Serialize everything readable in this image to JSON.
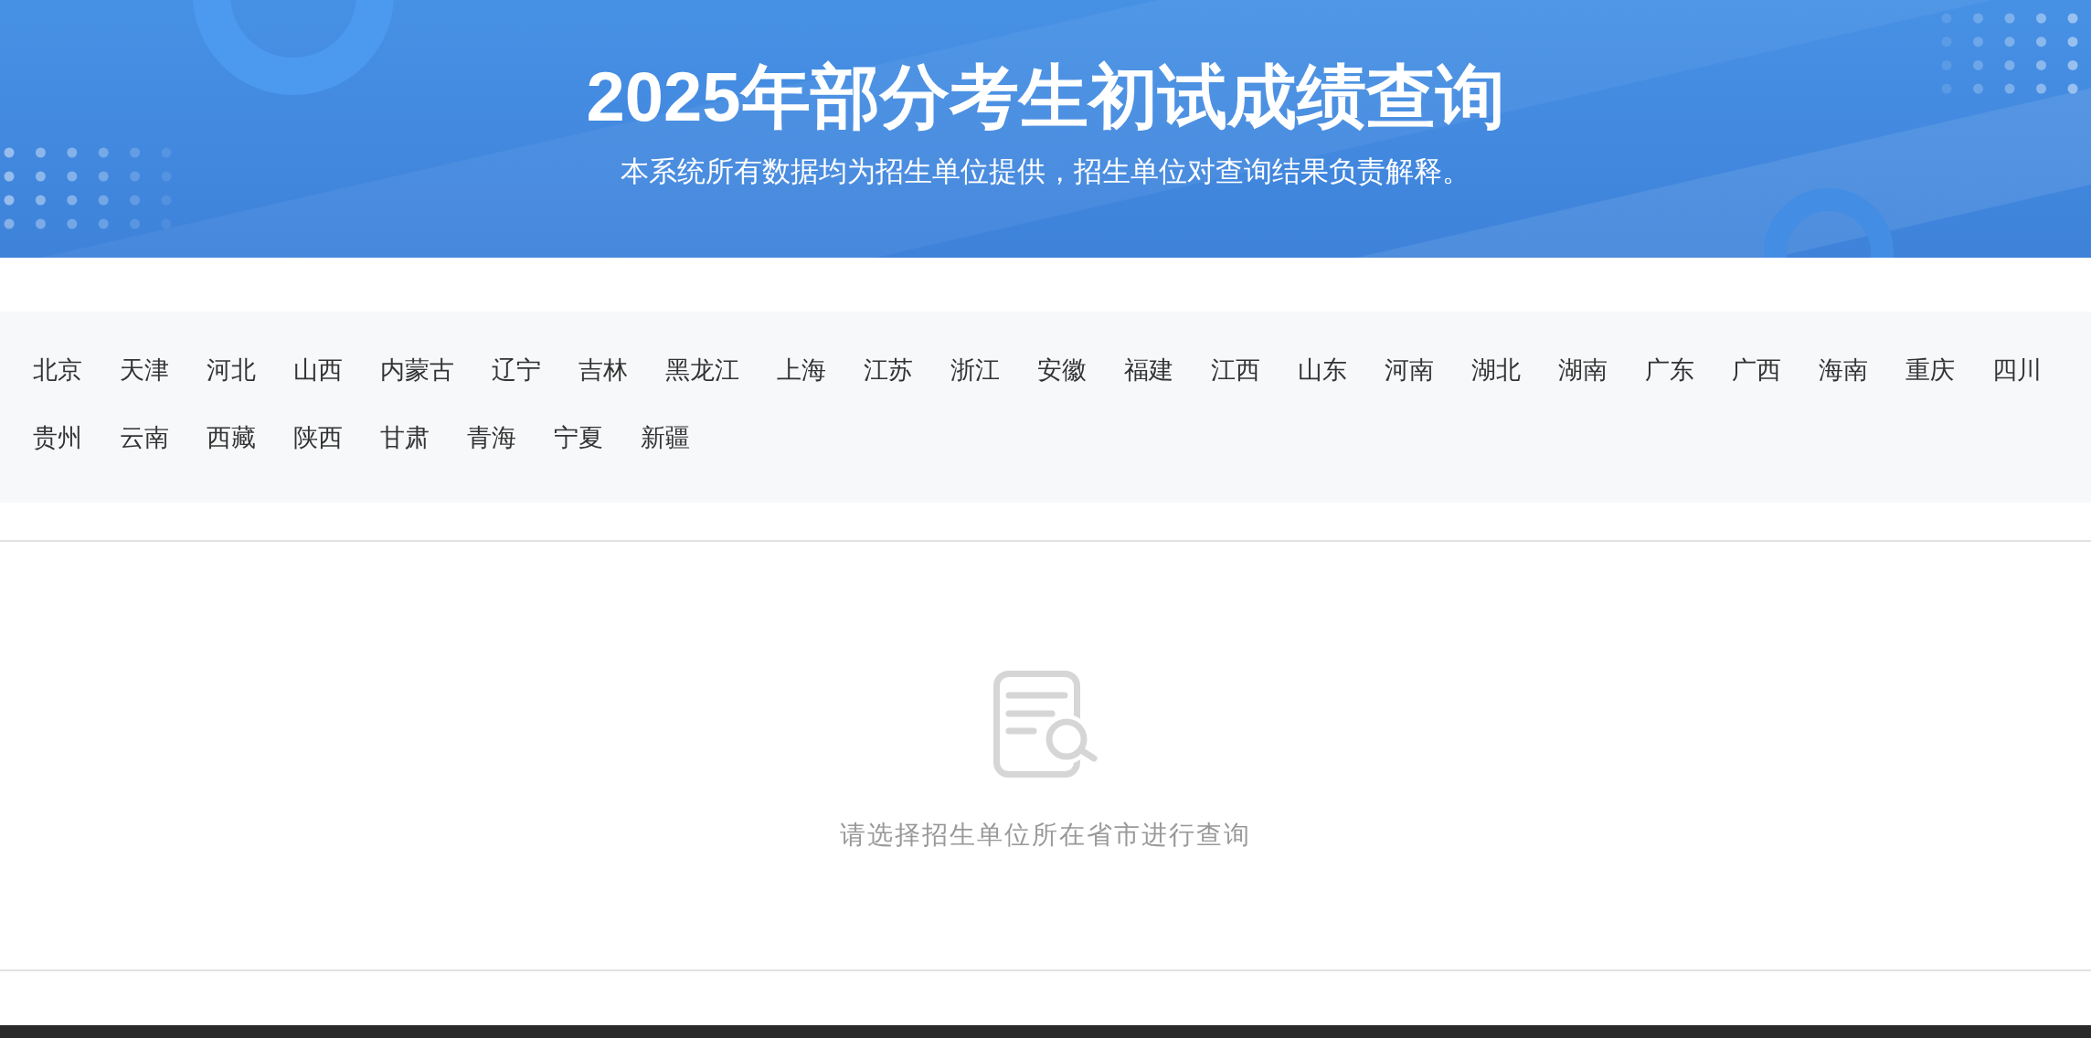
{
  "header": {
    "title": "2025年部分考生初试成绩查询",
    "subtitle": "本系统所有数据均为招生单位提供，招生单位对查询结果负责解释。"
  },
  "provinces": [
    {
      "label": "北京",
      "selected": false
    },
    {
      "label": "天津",
      "selected": false
    },
    {
      "label": "河北",
      "selected": false
    },
    {
      "label": "山西",
      "selected": false
    },
    {
      "label": "内蒙古",
      "selected": false
    },
    {
      "label": "辽宁",
      "selected": false
    },
    {
      "label": "吉林",
      "selected": false
    },
    {
      "label": "黑龙江",
      "selected": false
    },
    {
      "label": "上海",
      "selected": false
    },
    {
      "label": "江苏",
      "selected": false
    },
    {
      "label": "浙江",
      "selected": false
    },
    {
      "label": "安徽",
      "selected": false
    },
    {
      "label": "福建",
      "selected": false
    },
    {
      "label": "江西",
      "selected": false
    },
    {
      "label": "山东",
      "selected": false
    },
    {
      "label": "河南",
      "selected": false
    },
    {
      "label": "湖北",
      "selected": false
    },
    {
      "label": "湖南",
      "selected": false
    },
    {
      "label": "广东",
      "selected": false
    },
    {
      "label": "广西",
      "selected": false
    },
    {
      "label": "海南",
      "selected": false
    },
    {
      "label": "重庆",
      "selected": false
    },
    {
      "label": "四川",
      "selected": false
    },
    {
      "label": "贵州",
      "selected": false
    },
    {
      "label": "云南",
      "selected": false
    },
    {
      "label": "西藏",
      "selected": false
    },
    {
      "label": "陕西",
      "selected": false
    },
    {
      "label": "甘肃",
      "selected": false
    },
    {
      "label": "青海",
      "selected": false
    },
    {
      "label": "宁夏",
      "selected": false
    },
    {
      "label": "新疆",
      "selected": false
    }
  ],
  "empty_state": {
    "message": "请选择招生单位所在省市进行查询"
  }
}
